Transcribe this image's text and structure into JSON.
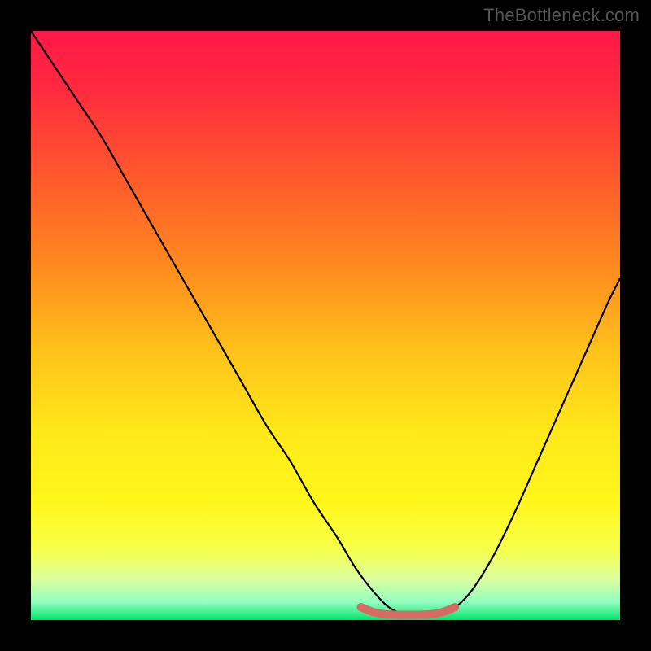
{
  "watermark": "TheBottleneck.com",
  "chart_data": {
    "type": "line",
    "title": "",
    "xlabel": "",
    "ylabel": "",
    "xlim": [
      0,
      100
    ],
    "ylim": [
      0,
      100
    ],
    "grid": false,
    "legend": false,
    "gradient_stops": [
      {
        "offset": 0.0,
        "color": "#ff1846"
      },
      {
        "offset": 0.1,
        "color": "#ff2a3f"
      },
      {
        "offset": 0.25,
        "color": "#ff5a2c"
      },
      {
        "offset": 0.4,
        "color": "#ff8a1f"
      },
      {
        "offset": 0.55,
        "color": "#ffc41a"
      },
      {
        "offset": 0.68,
        "color": "#ffe81a"
      },
      {
        "offset": 0.8,
        "color": "#fff71a"
      },
      {
        "offset": 0.88,
        "color": "#f6ff4a"
      },
      {
        "offset": 0.93,
        "color": "#dcffa0"
      },
      {
        "offset": 0.97,
        "color": "#8fffc0"
      },
      {
        "offset": 1.0,
        "color": "#00e56a"
      }
    ],
    "series": [
      {
        "name": "bottleneck-curve",
        "color": "#000000",
        "x": [
          0,
          4,
          8,
          12,
          16,
          20,
          24,
          28,
          32,
          36,
          40,
          44,
          48,
          52,
          55,
          58,
          61,
          64,
          67,
          70,
          74,
          78,
          82,
          86,
          90,
          94,
          98,
          100
        ],
        "y": [
          100,
          94,
          88,
          82,
          75,
          68,
          61,
          54,
          47,
          40,
          33,
          27,
          20,
          14,
          9,
          5,
          2,
          1,
          1,
          1,
          4,
          10,
          18,
          27,
          36,
          45,
          54,
          58
        ]
      },
      {
        "name": "optimal-band",
        "color": "#d76a63",
        "x": [
          56,
          58,
          60,
          62,
          64,
          66,
          68,
          70,
          72
        ],
        "y": [
          2.2,
          1.4,
          1.0,
          0.9,
          0.9,
          0.9,
          1.0,
          1.4,
          2.2
        ]
      }
    ]
  }
}
